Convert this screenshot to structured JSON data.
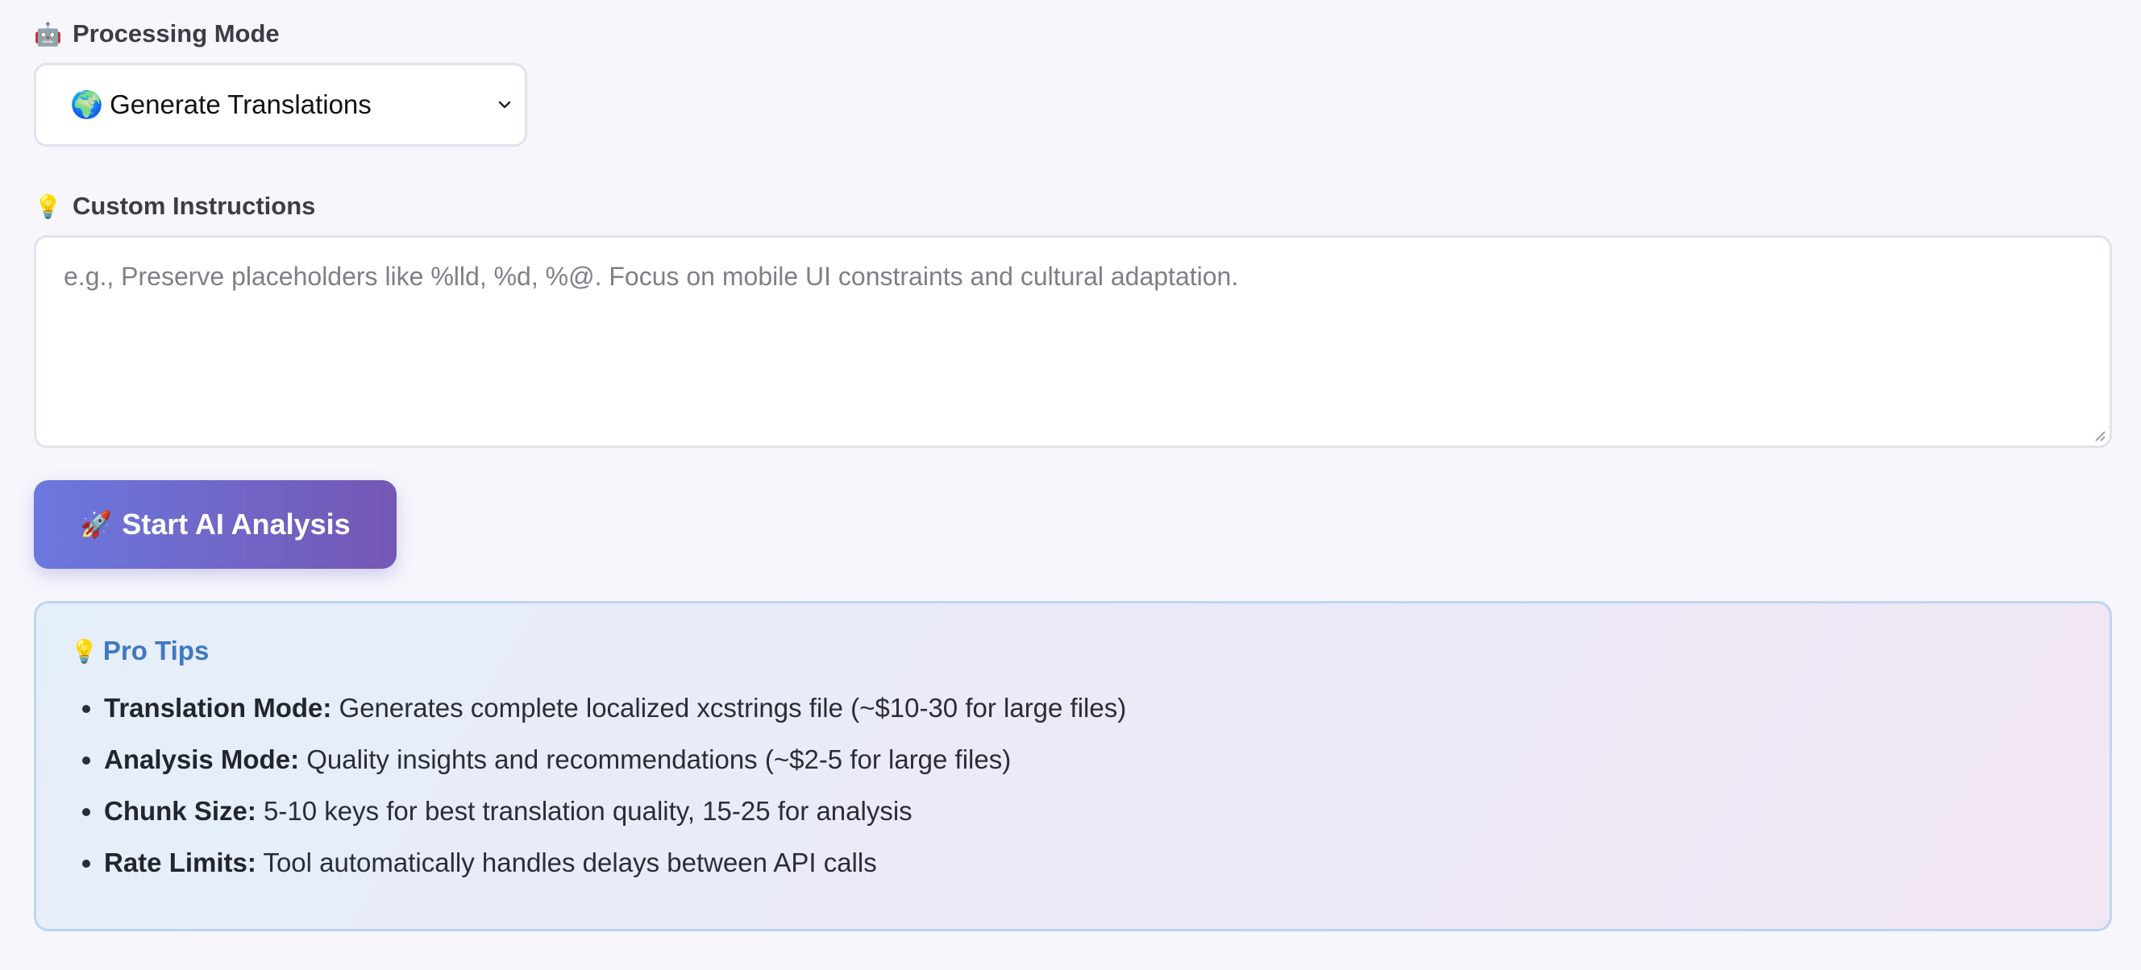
{
  "processing_mode": {
    "label_emoji": "🤖",
    "label": "Processing Mode",
    "selected_emoji": "🌍",
    "selected": "Generate Translations"
  },
  "custom_instructions": {
    "label_emoji": "💡",
    "label": "Custom Instructions",
    "placeholder": "e.g., Preserve placeholders like %lld, %d, %@. Focus on mobile UI constraints and cultural adaptation."
  },
  "start_button": {
    "emoji": "🚀",
    "label": "Start AI Analysis"
  },
  "pro_tips": {
    "emoji": "💡",
    "title": "Pro Tips",
    "items": [
      {
        "term": "Translation Mode:",
        "text": " Generates complete localized xcstrings file (~$10-30 for large files)"
      },
      {
        "term": "Analysis Mode:",
        "text": " Quality insights and recommendations (~$2-5 for large files)"
      },
      {
        "term": "Chunk Size:",
        "text": " 5-10 keys for best translation quality, 15-25 for analysis"
      },
      {
        "term": "Rate Limits:",
        "text": " Tool automatically handles delays between API calls"
      }
    ]
  },
  "colors": {
    "background": "#f6f6fc",
    "button_gradient_start": "#6b78de",
    "button_gradient_end": "#7557b4",
    "tips_title": "#3e78c4",
    "tips_border": "#bcd6f2"
  }
}
